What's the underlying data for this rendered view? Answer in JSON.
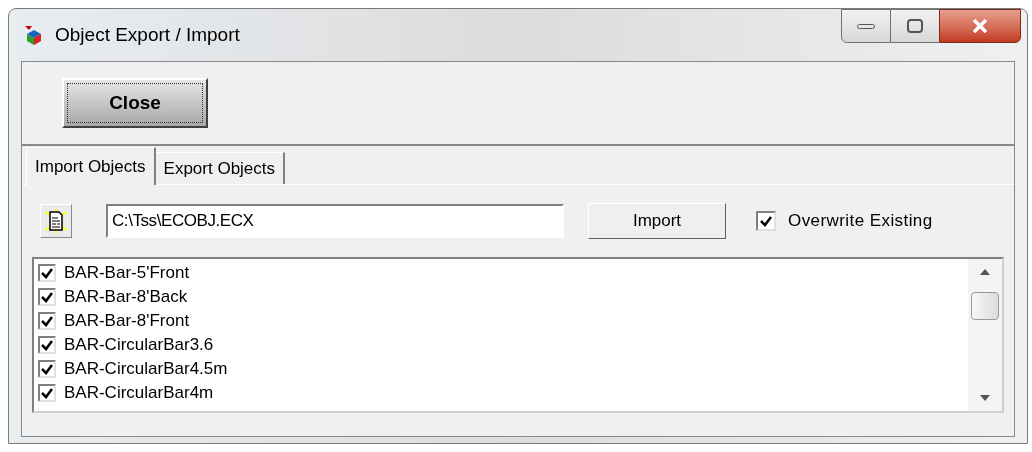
{
  "window": {
    "title": "Object Export / Import"
  },
  "close_button": "Close",
  "tabs": [
    {
      "label": "Import Objects",
      "selected": true
    },
    {
      "label": "Export Objects",
      "selected": false
    }
  ],
  "file_path": {
    "value": "C:\\Tss\\ECOBJ.ECX"
  },
  "import_button": "Import",
  "overwrite_existing": {
    "label": "Overwrite Existing",
    "checked": true
  },
  "objects": [
    {
      "name": "BAR-Bar-5'Front",
      "checked": true
    },
    {
      "name": "BAR-Bar-8'Back",
      "checked": true
    },
    {
      "name": "BAR-Bar-8'Front",
      "checked": true
    },
    {
      "name": "BAR-CircularBar3.6",
      "checked": true
    },
    {
      "name": "BAR-CircularBar4.5m",
      "checked": true
    },
    {
      "name": "BAR-CircularBar4m",
      "checked": true
    }
  ]
}
